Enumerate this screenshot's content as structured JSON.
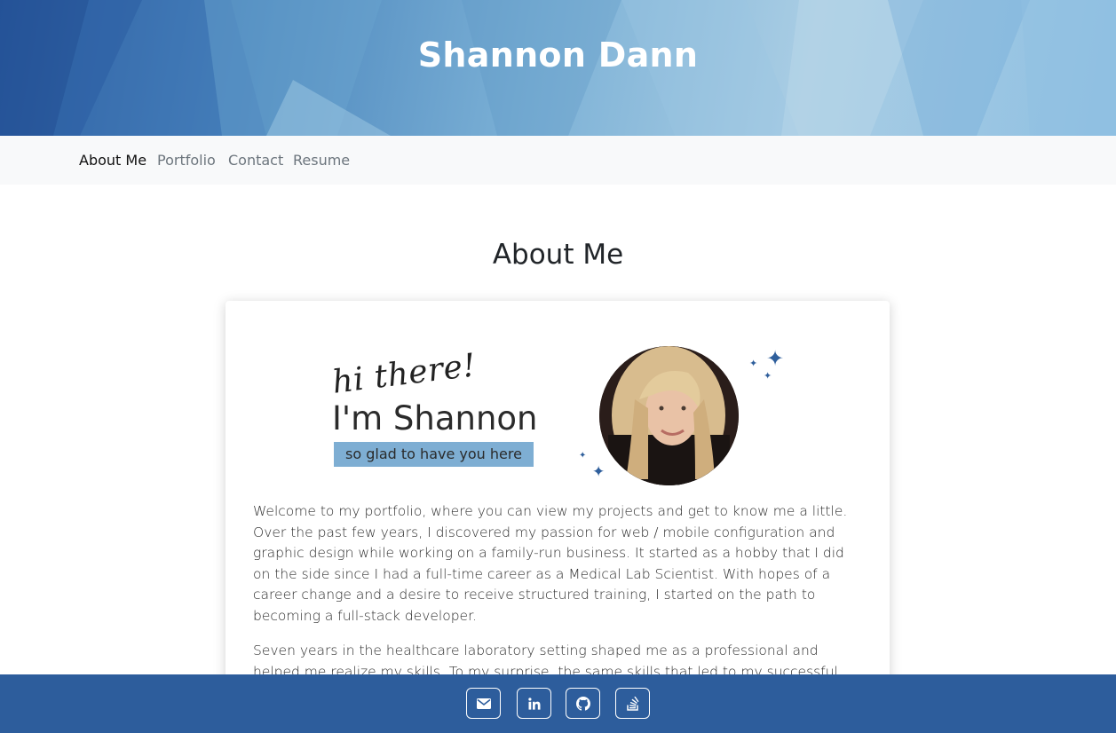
{
  "header": {
    "title": "Shannon Dann"
  },
  "nav": {
    "items": [
      {
        "label": "About Me",
        "active": true
      },
      {
        "label": "Portfolio",
        "active": false
      },
      {
        "label": "Contact",
        "active": false
      },
      {
        "label": "Resume",
        "active": false
      }
    ]
  },
  "section": {
    "title": "About Me"
  },
  "greeting": {
    "script": "hi there!",
    "name": "I'm Shannon",
    "tagline": "so glad to have you here"
  },
  "about": {
    "paragraphs": [
      "Welcome to my portfolio, where you can view my projects and get to know me a little. Over the past few years, I discovered my passion for web / mobile configuration and graphic design while working on a family-run business. It started as a hobby that I did on the side since I had a full-time career as a Medical Lab Scientist. With hopes of a career change and a desire to receive structured training, I started on the path to becoming a full-stack developer.",
      "Seven years in the healthcare laboratory setting shaped me as a professional and helped me realize my skills. To my surprise, the same skills that led to my successful laboratory career are also skills needed in web development."
    ]
  },
  "footer": {
    "links": [
      {
        "icon": "envelope-icon"
      },
      {
        "icon": "linkedin-icon"
      },
      {
        "icon": "github-icon"
      },
      {
        "icon": "stack-overflow-icon"
      }
    ]
  },
  "colors": {
    "footer_bg": "#2d5d9c",
    "banner_bg": "#7eaed3",
    "nav_bg": "#f8f9fa",
    "sparkle": "#2f5f9c"
  }
}
